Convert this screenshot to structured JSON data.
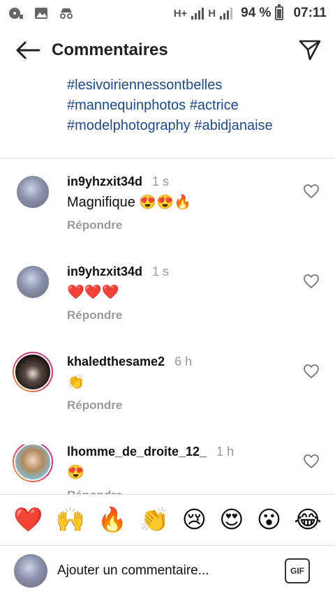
{
  "status_bar": {
    "battery_percent": "94 %",
    "time": "07:11",
    "network_1": "H+",
    "network_2": "H"
  },
  "header": {
    "title": "Commentaires"
  },
  "caption": {
    "hashtags": [
      "#lesivoiriennessontbelles",
      "#mannequinphotos #actrice",
      "#modelphotography #abidjanaise"
    ]
  },
  "comments": [
    {
      "username": "in9yhzxit34d",
      "time": "1 s",
      "text": "Magnifique 😍😍🔥",
      "reply_label": "Répondre"
    },
    {
      "username": "in9yhzxit34d",
      "time": "1 s",
      "text": "❤️❤️❤️",
      "reply_label": "Répondre"
    },
    {
      "username": "khaledthesame2",
      "time": "6 h",
      "text": "👏",
      "reply_label": "Répondre"
    },
    {
      "username": "lhomme_de_droite_12_",
      "time": "1 h",
      "text": "😍",
      "reply_label": "Répondre"
    }
  ],
  "emoji_bar": [
    "❤️",
    "🙌",
    "🔥",
    "👏",
    "😢",
    "😍",
    "😮",
    "😂"
  ],
  "input": {
    "placeholder": "Ajouter un commentaire...",
    "gif_label": "GIF"
  },
  "icons": {
    "back": "arrow-left-icon",
    "send": "paper-plane-icon",
    "like": "heart-outline-icon"
  }
}
